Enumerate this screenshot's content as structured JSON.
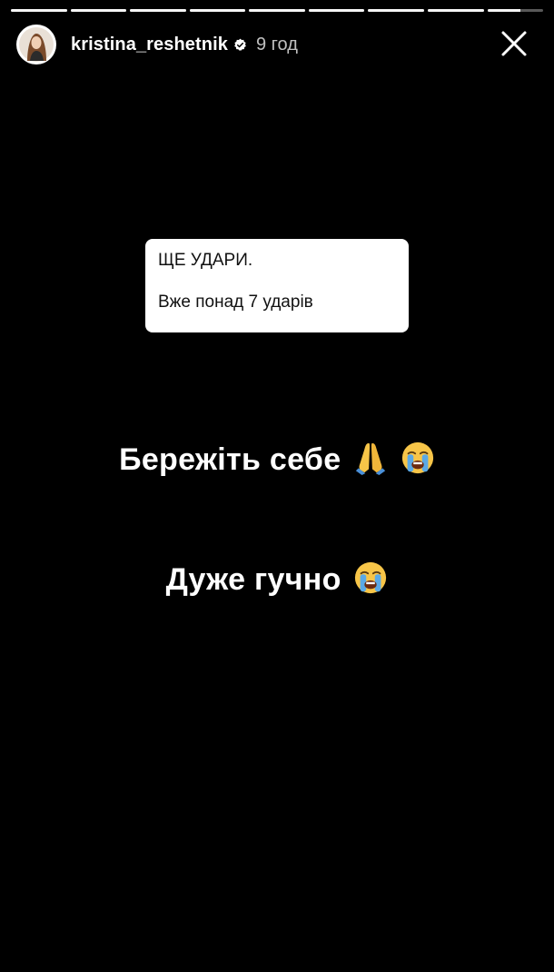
{
  "story": {
    "segments": 9,
    "active_segment": 8,
    "active_progress": 0.6
  },
  "header": {
    "username": "kristina_reshetnik",
    "verified": true,
    "time": "9 год"
  },
  "question_box": {
    "line1": "ЩЕ УДАРИ.",
    "line2": "Вже понад 7 ударів"
  },
  "messages": {
    "line1": "Бережіть себе",
    "line1_emojis": [
      "folded-hands-emoji",
      "loudly-crying-face-emoji"
    ],
    "line2": "Дуже гучно",
    "line2_emojis": [
      "loudly-crying-face-emoji"
    ]
  },
  "colors": {
    "background": "#000000",
    "text": "#ffffff",
    "question_box_bg": "#ffffff",
    "verified_badge": "#3897f0"
  },
  "icons": {
    "close": "close-icon",
    "verified": "verified-badge-icon"
  }
}
